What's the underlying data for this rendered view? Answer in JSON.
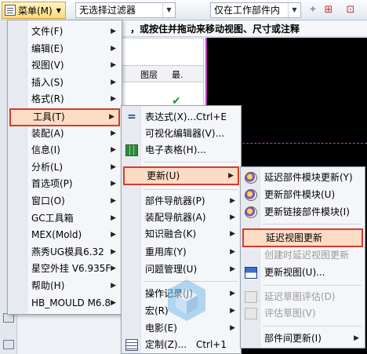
{
  "toolbar": {
    "menu_label": "菜单(M)",
    "filter_value": "无选择过滤器",
    "scope_value": "仅在工作部件内"
  },
  "hint": "，或按住并拖动来移动视图、尺寸或注释",
  "grid": {
    "col_layer": "图层",
    "col_latest": "最."
  },
  "main_menu": [
    {
      "label": "文件(F)",
      "has_sub": true
    },
    {
      "label": "编辑(E)",
      "has_sub": true
    },
    {
      "label": "视图(V)",
      "has_sub": true
    },
    {
      "label": "插入(S)",
      "has_sub": true
    },
    {
      "label": "格式(R)",
      "has_sub": true
    },
    {
      "label": "工具(T)",
      "has_sub": true,
      "highlighted": true
    },
    {
      "label": "装配(A)",
      "has_sub": true
    },
    {
      "label": "信息(I)",
      "has_sub": true
    },
    {
      "label": "分析(L)",
      "has_sub": true
    },
    {
      "label": "首选项(P)",
      "has_sub": true
    },
    {
      "label": "窗口(O)",
      "has_sub": true
    },
    {
      "label": "GC工具箱",
      "has_sub": true
    },
    {
      "label": "MEX(Mold)",
      "has_sub": true
    },
    {
      "label": "燕秀UG模具6.32",
      "has_sub": true
    },
    {
      "label": "星空外挂 V6.935F",
      "has_sub": true
    },
    {
      "label": "帮助(H)",
      "has_sub": true
    },
    {
      "label": "HB_MOULD M6.8",
      "has_sub": true
    }
  ],
  "tools_menu": {
    "expression": {
      "label": "表达式(X)...",
      "accel": "Ctrl+E",
      "icon": "equals-icon"
    },
    "visual_editor": {
      "label": "可视化编辑器(V)..."
    },
    "spreadsheet": {
      "label": "电子表格(H)...",
      "icon": "spreadsheet-icon"
    },
    "update": {
      "label": "更新(U)"
    },
    "part_navigator": {
      "label": "部件导航器(P)"
    },
    "assembly_navigator": {
      "label": "装配导航器(A)"
    },
    "knowledge_fusion": {
      "label": "知识融合(K)"
    },
    "reuse_library": {
      "label": "重用库(Y)"
    },
    "issue_management": {
      "label": "问题管理(U)"
    },
    "operation_record": {
      "label": "操作记录(J)"
    },
    "macro": {
      "label": "宏(R)"
    },
    "movie": {
      "label": "电影(E)"
    },
    "customize": {
      "label": "定制(Z)...",
      "accel": "Ctrl+1",
      "icon": "customize-icon"
    }
  },
  "update_menu": {
    "deferred_module_update": {
      "label": "延迟部件模块更新(Y)"
    },
    "update_part_module": {
      "label": "更新部件模块(U)"
    },
    "update_linked_module": {
      "label": "更新链接部件模块(I)"
    },
    "deferred_view_update": {
      "label": "延迟视图更新"
    },
    "create_deferred": {
      "label": "创建时延迟视图更新"
    },
    "update_view": {
      "label": "更新视图(U)..."
    },
    "deferred_drawing_eval": {
      "label": "延迟草图评估(D)"
    },
    "evaluate_sketch": {
      "label": "评估草图(V)"
    },
    "interpart_update": {
      "label": "部件间更新(I)"
    }
  }
}
